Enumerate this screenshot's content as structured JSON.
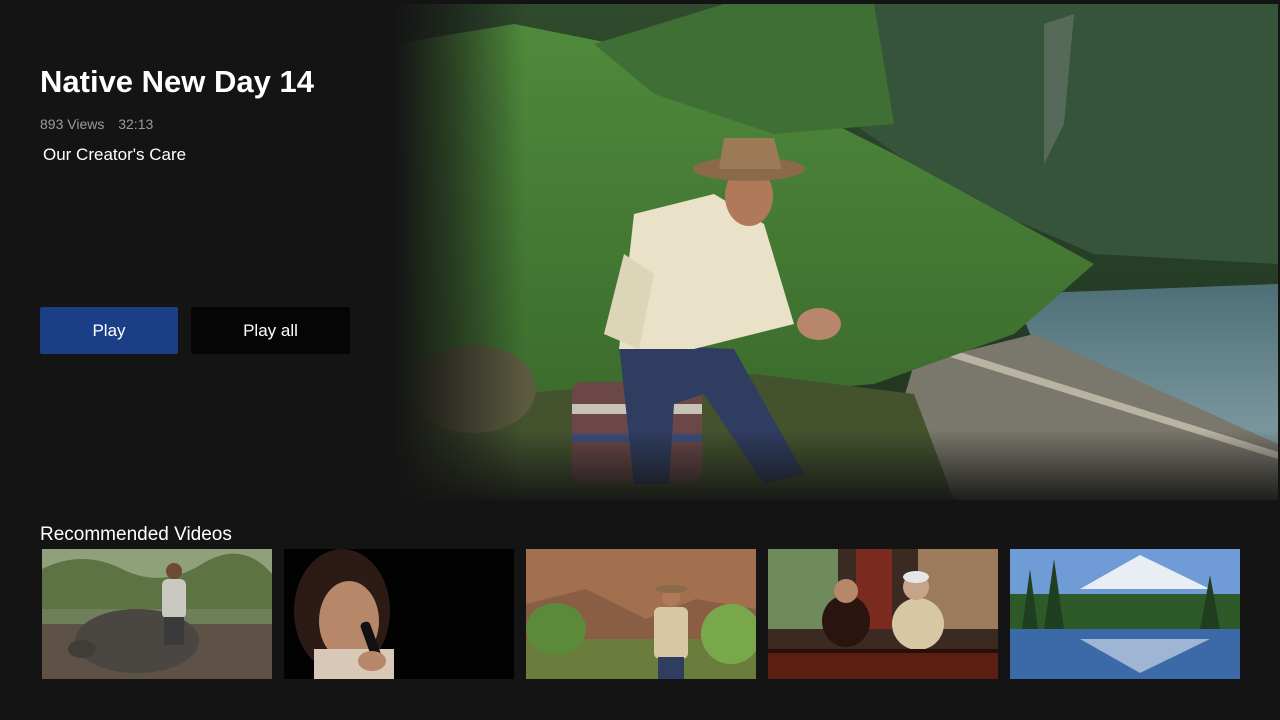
{
  "hero": {
    "title": "Native New Day 14",
    "views": "893 Views",
    "duration": "32:13",
    "subtitle": "Our Creator's Care",
    "play_label": "Play",
    "play_all_label": "Play all"
  },
  "recommended": {
    "heading": "Recommended Videos",
    "items": [
      {
        "scene": "man-with-giant-tortoise"
      },
      {
        "scene": "woman-singing-with-microphone"
      },
      {
        "scene": "man-in-canyon"
      },
      {
        "scene": "two-hosts-at-desk"
      },
      {
        "scene": "mountain-lake-reflection"
      }
    ]
  },
  "colors": {
    "background": "#141414",
    "play_button": "#1b3f86",
    "play_all_button": "#050505",
    "meta_text": "#9a9a9a"
  }
}
